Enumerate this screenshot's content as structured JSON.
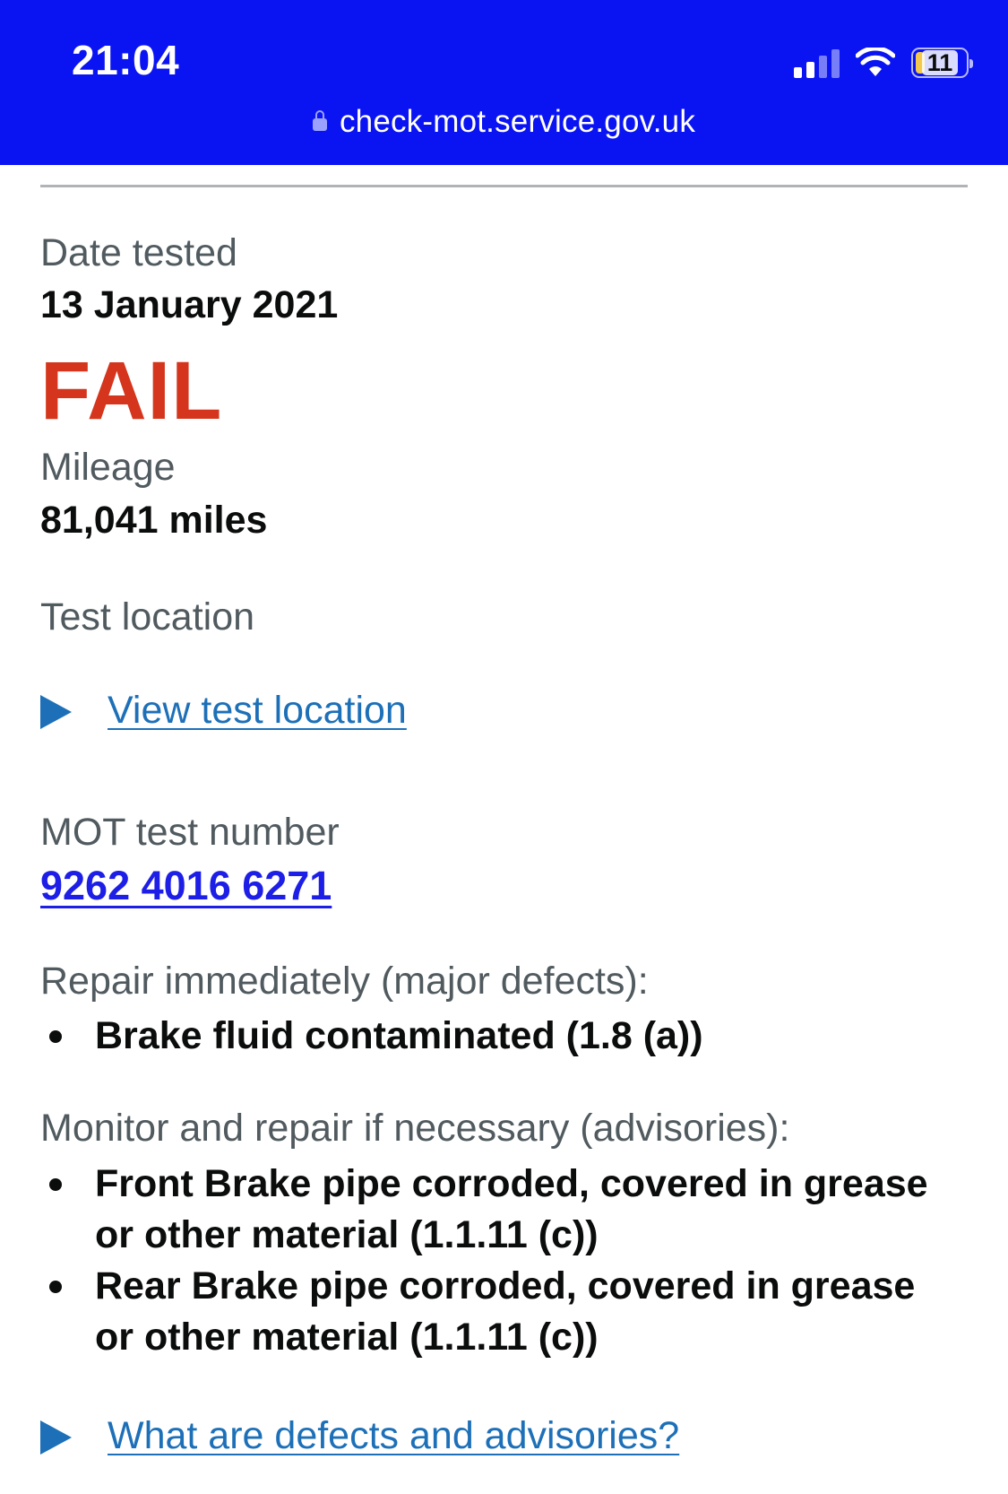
{
  "status_bar": {
    "time": "21:04",
    "battery": "11",
    "url": "check-mot.service.gov.uk"
  },
  "record": {
    "date_label": "Date tested",
    "date_value": "13 January 2021",
    "result": "FAIL",
    "mileage_label": "Mileage",
    "mileage_value": "81,041 miles",
    "location_label": "Test location",
    "location_link": "View test location",
    "mot_label": "MOT test number",
    "mot_number": "9262 4016 6271",
    "major_label": "Repair immediately (major defects):",
    "major_defects": [
      "Brake fluid contaminated (1.8 (a))"
    ],
    "advisory_label": "Monitor and repair if necessary (advisories):",
    "advisories": [
      "Front Brake pipe corroded, covered in grease or other material (1.1.11 (c))",
      "Rear Brake pipe corroded, covered in grease or other material (1.1.11 (c))"
    ],
    "help_link": "What are defects and advisories?"
  },
  "colors": {
    "header": "#0a14f2",
    "fail": "#d4351c",
    "link": "#1d70b8",
    "mot_number": "#1d1ee6"
  }
}
